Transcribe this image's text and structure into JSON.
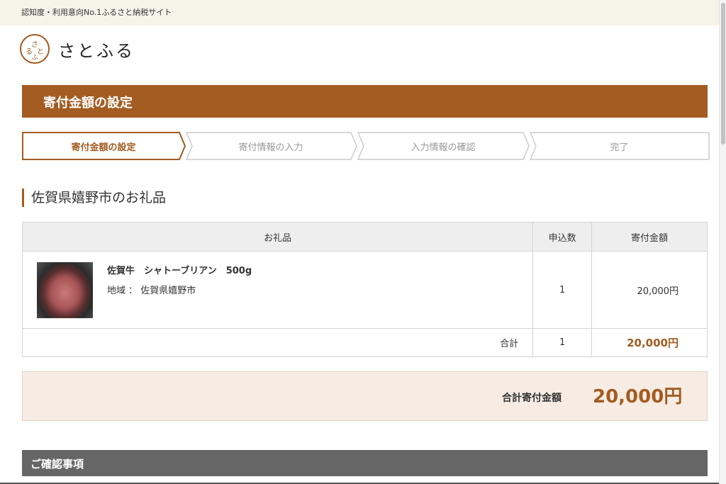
{
  "topbar": {
    "text": "認知度・利用意向No.1ふるさと納税サイト"
  },
  "logo": {
    "mark_text": "さとふる",
    "text": "さとふる"
  },
  "page_title": "寄付金額の設定",
  "steps": [
    {
      "label": "寄付金額の設定",
      "active": true
    },
    {
      "label": "寄付情報の入力",
      "active": false
    },
    {
      "label": "入力情報の確認",
      "active": false
    },
    {
      "label": "完了",
      "active": false
    }
  ],
  "section_heading": "佐賀県嬉野市のお礼品",
  "table": {
    "headers": [
      "お礼品",
      "申込数",
      "寄付金額"
    ],
    "items": [
      {
        "name": "佐賀牛　シャトーブリアン　500g",
        "region": "地域 ： 佐賀県嬉野市",
        "quantity": "1",
        "amount": "20,000円"
      }
    ],
    "total": {
      "label": "合計",
      "quantity": "1",
      "amount": "20,000円"
    }
  },
  "summary": {
    "label": "合計寄付金額",
    "value": "20,000円"
  },
  "confirm_heading": "ご確認事項",
  "colors": {
    "accent": "#a35c21",
    "topbar_bg": "#f6f3e9",
    "summary_bg": "#f7ece3",
    "confirm_bg": "#666666"
  }
}
